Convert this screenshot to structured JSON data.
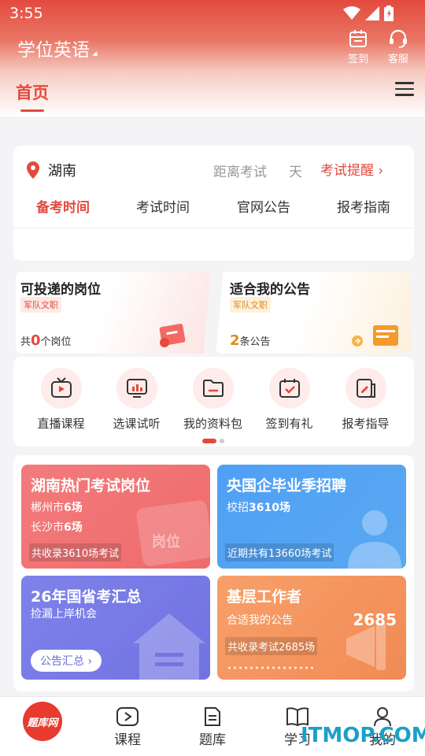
{
  "status_bar": {
    "time": "3:55"
  },
  "header": {
    "app_title": "学位英语",
    "sign_in_label": "签到",
    "service_label": "客服"
  },
  "tabs": {
    "home_label": "首页"
  },
  "exam_card": {
    "location": "湖南",
    "distance_label": "距离考试",
    "day_unit": "天",
    "reminder_label": "考试提醒",
    "tabs": [
      "备考时间",
      "考试时间",
      "官网公告",
      "报考指南"
    ]
  },
  "position_cards": [
    {
      "title": "可投递的岗位",
      "tag": "军队文职",
      "prefix": "共",
      "count": "0",
      "suffix": "个岗位"
    },
    {
      "title": "适合我的公告",
      "tag": "军队文职",
      "prefix": "",
      "count": "2",
      "suffix": "条公告"
    }
  ],
  "quick_links": [
    {
      "label": "直播课程",
      "icon": "live-tv-icon"
    },
    {
      "label": "选课试听",
      "icon": "chart-screen-icon"
    },
    {
      "label": "我的资料包",
      "icon": "folder-icon"
    },
    {
      "label": "签到有礼",
      "icon": "calendar-check-icon"
    },
    {
      "label": "报考指导",
      "icon": "clipboard-edit-icon"
    }
  ],
  "promo_tiles": {
    "hot_positions": {
      "title": "湖南热门考试岗位",
      "line1_city": "郴州市",
      "line1_value": "6场",
      "line2_city": "长沙市",
      "line2_value": "6场",
      "note": "共收录3610场考试",
      "bg_text": "岗位"
    },
    "soe_recruit": {
      "title": "央国企毕业季招聘",
      "line1_label": "校招",
      "line1_value": "3610场",
      "note": "近期共有13660场考试"
    },
    "exam_summary": {
      "title": "26年国省考汇总",
      "subtitle": "捡漏上岸机会",
      "button_label": "公告汇总"
    },
    "grassroots": {
      "title": "基层工作者",
      "subtitle": "合适我的公告",
      "number": "2685",
      "note": "共收录考试2685场"
    }
  },
  "bottom_nav": {
    "logo_text": "题库网",
    "items": [
      "课程",
      "题库",
      "学习",
      "我的"
    ]
  },
  "watermark": "ITMOP.COM",
  "colors": {
    "accent": "#e24a3d",
    "red_tile": "#f07070",
    "blue_tile": "#4f9cf0",
    "purple_tile": "#7b7fe8",
    "orange_tile": "#f5945e"
  }
}
